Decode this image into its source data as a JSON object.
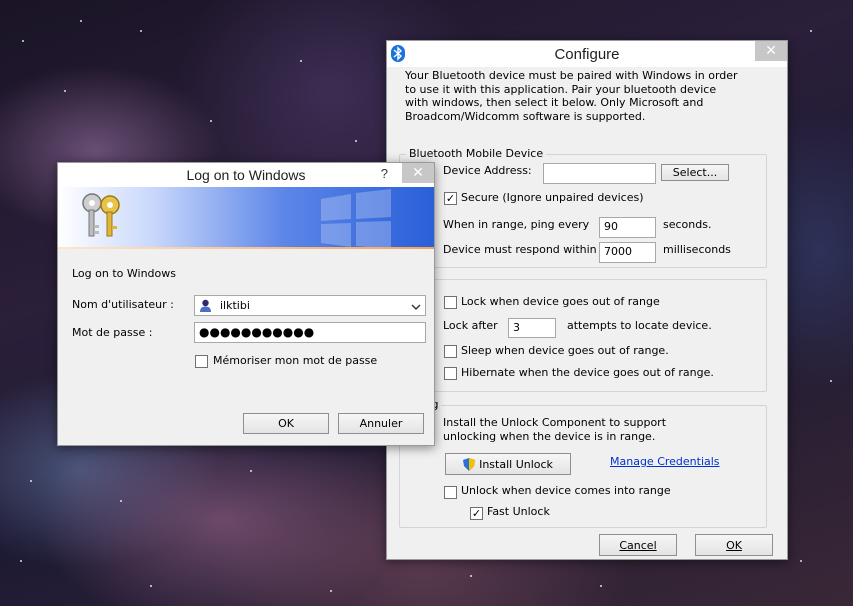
{
  "configure": {
    "title": "Configure",
    "close_glyph": "✕",
    "intro_lines": [
      "Your Bluetooth device must be paired with Windows in order",
      "to use it with this application.  Pair your bluetooth device",
      "with windows, then select it below.  Only Microsoft and",
      "Broadcom/Widcomm software is supported."
    ],
    "bluetooth_group": {
      "legend": "Bluetooth Mobile Device",
      "device_address_label": "Device Address:",
      "device_address_value": "",
      "select_button": "Select...",
      "secure_label": "Secure (Ignore unpaired devices)",
      "secure_checked": true,
      "ping_label": "When in range, ping every",
      "ping_value": "90",
      "ping_unit": "seconds.",
      "respond_label": "Device must respond within",
      "respond_value": "7000",
      "respond_unit": "milliseconds"
    },
    "locking_group": {
      "legend": "ing",
      "lock_out_of_range_label": "Lock when device goes out of range",
      "lock_out_of_range_checked": false,
      "lock_after_label": "Lock after",
      "lock_after_value": "3",
      "lock_after_unit": "attempts to locate device.",
      "sleep_label": "Sleep when device goes out of range.",
      "sleep_checked": false,
      "hibernate_label": "Hibernate when the device goes out of range.",
      "hibernate_checked": false
    },
    "unlocking_group": {
      "legend": "cking",
      "install_lines": [
        "Install the Unlock Component to support",
        "unlocking when the device is in range."
      ],
      "install_button": "Install Unlock",
      "manage_link": "Manage Credentials",
      "unlock_in_range_label": "Unlock when device comes into range",
      "unlock_in_range_checked": false,
      "fast_unlock_label": "Fast Unlock",
      "fast_unlock_checked": true
    },
    "cancel_button": "Cancel",
    "ok_button": "OK"
  },
  "logon": {
    "title": "Log on to Windows",
    "help_glyph": "?",
    "close_glyph": "✕",
    "heading": "Log on to Windows",
    "username_label": "Nom d'utilisateur :",
    "username_value": "ilktibi",
    "password_label": "Mot de passe :",
    "password_value": "●●●●●●●●●●●",
    "remember_label": "Mémoriser mon mot de passe",
    "remember_checked": false,
    "ok_button": "OK",
    "cancel_button": "Annuler"
  },
  "colors": {
    "banner_start": "#ffffff",
    "banner_end": "#2a5fd8",
    "banner_stripe": "#f5a25a",
    "link": "#0033cc",
    "bluetooth_icon": "#1a73d9"
  },
  "icons": {
    "configure_app": "bluetooth-icon",
    "keys": "keys-icon",
    "user": "user-icon",
    "shield": "uac-shield-icon",
    "dropdown": "chevron-down-icon"
  }
}
